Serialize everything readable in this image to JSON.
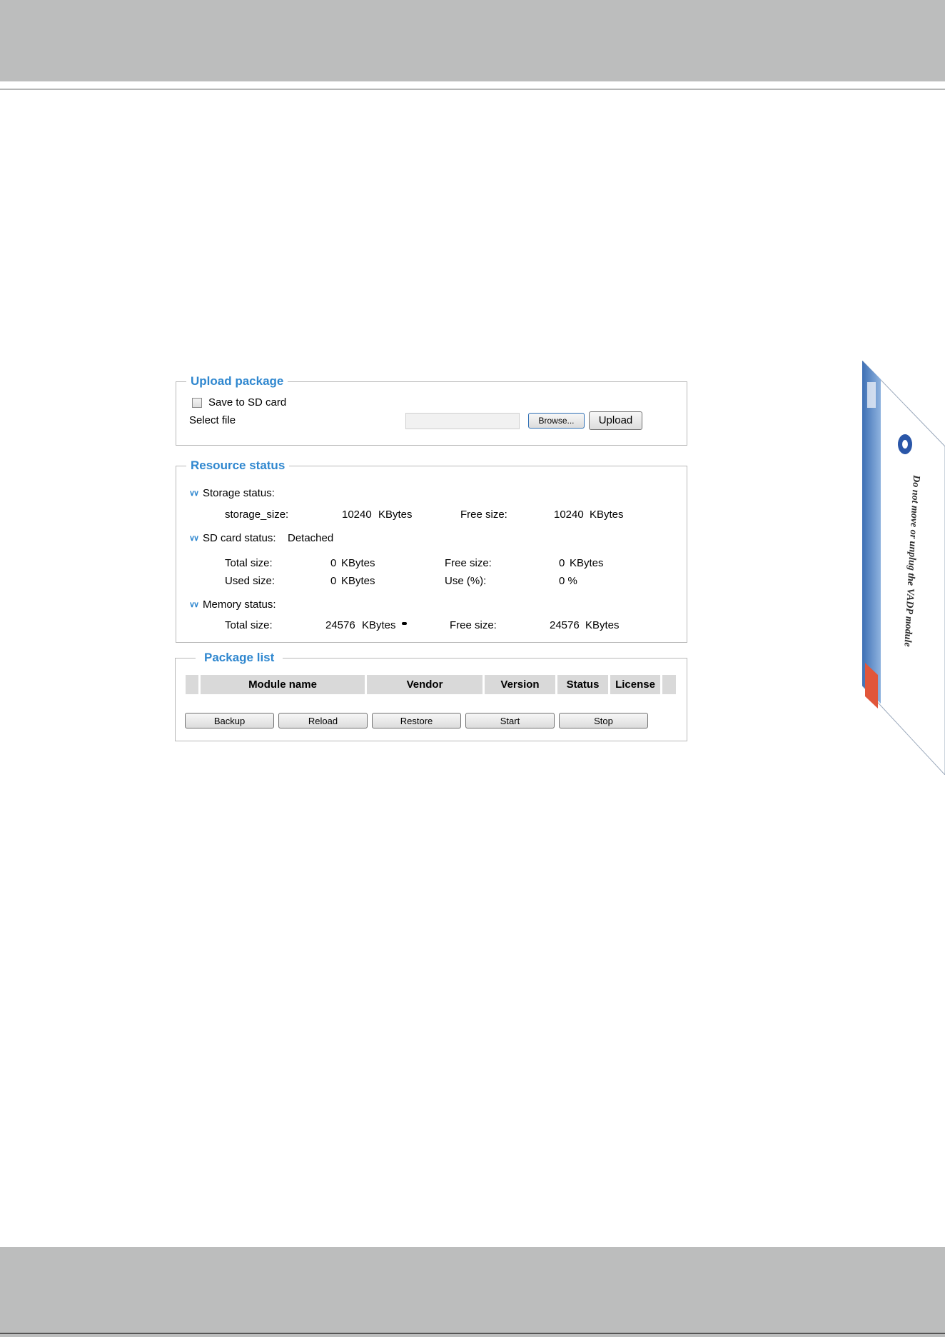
{
  "upload_package": {
    "legend": "Upload package",
    "save_to_sd_label": "Save to SD card",
    "select_file_label": "Select file",
    "file_value": "",
    "browse_label": "Browse...",
    "upload_label": "Upload"
  },
  "resource_status": {
    "legend": "Resource status",
    "storage": {
      "heading": "Storage status:",
      "size_label": "storage_size:",
      "size_value": "10240",
      "size_unit": "KBytes",
      "free_label": "Free size:",
      "free_value": "10240",
      "free_unit": "KBytes"
    },
    "sd_card": {
      "heading": "SD card status:",
      "state": "Detached",
      "total_label": "Total size:",
      "total_value": "0",
      "total_unit": "KBytes",
      "free_label": "Free size:",
      "free_value": "0",
      "free_unit": "KBytes",
      "used_label": "Used size:",
      "used_value": "0",
      "used_unit": "KBytes",
      "use_pct_label": "Use (%):",
      "use_pct_value": "0 %"
    },
    "memory": {
      "heading": "Memory status:",
      "total_label": "Total size:",
      "total_value": "24576",
      "total_unit": "KBytes",
      "free_label": "Free size:",
      "free_value": "24576",
      "free_unit": "KBytes"
    }
  },
  "package_list": {
    "legend": "Package list",
    "columns": [
      "Module name",
      "Vendor",
      "Version",
      "Status",
      "License"
    ],
    "buttons": [
      "Backup",
      "Reload",
      "Restore",
      "Start",
      "Stop"
    ]
  },
  "side_graphic": {
    "caption": "Do not move or unplug the VADP module"
  },
  "colors": {
    "band": "#bcbdbd",
    "legend": "#2f87cf",
    "header_cell": "#d9d9d9"
  }
}
